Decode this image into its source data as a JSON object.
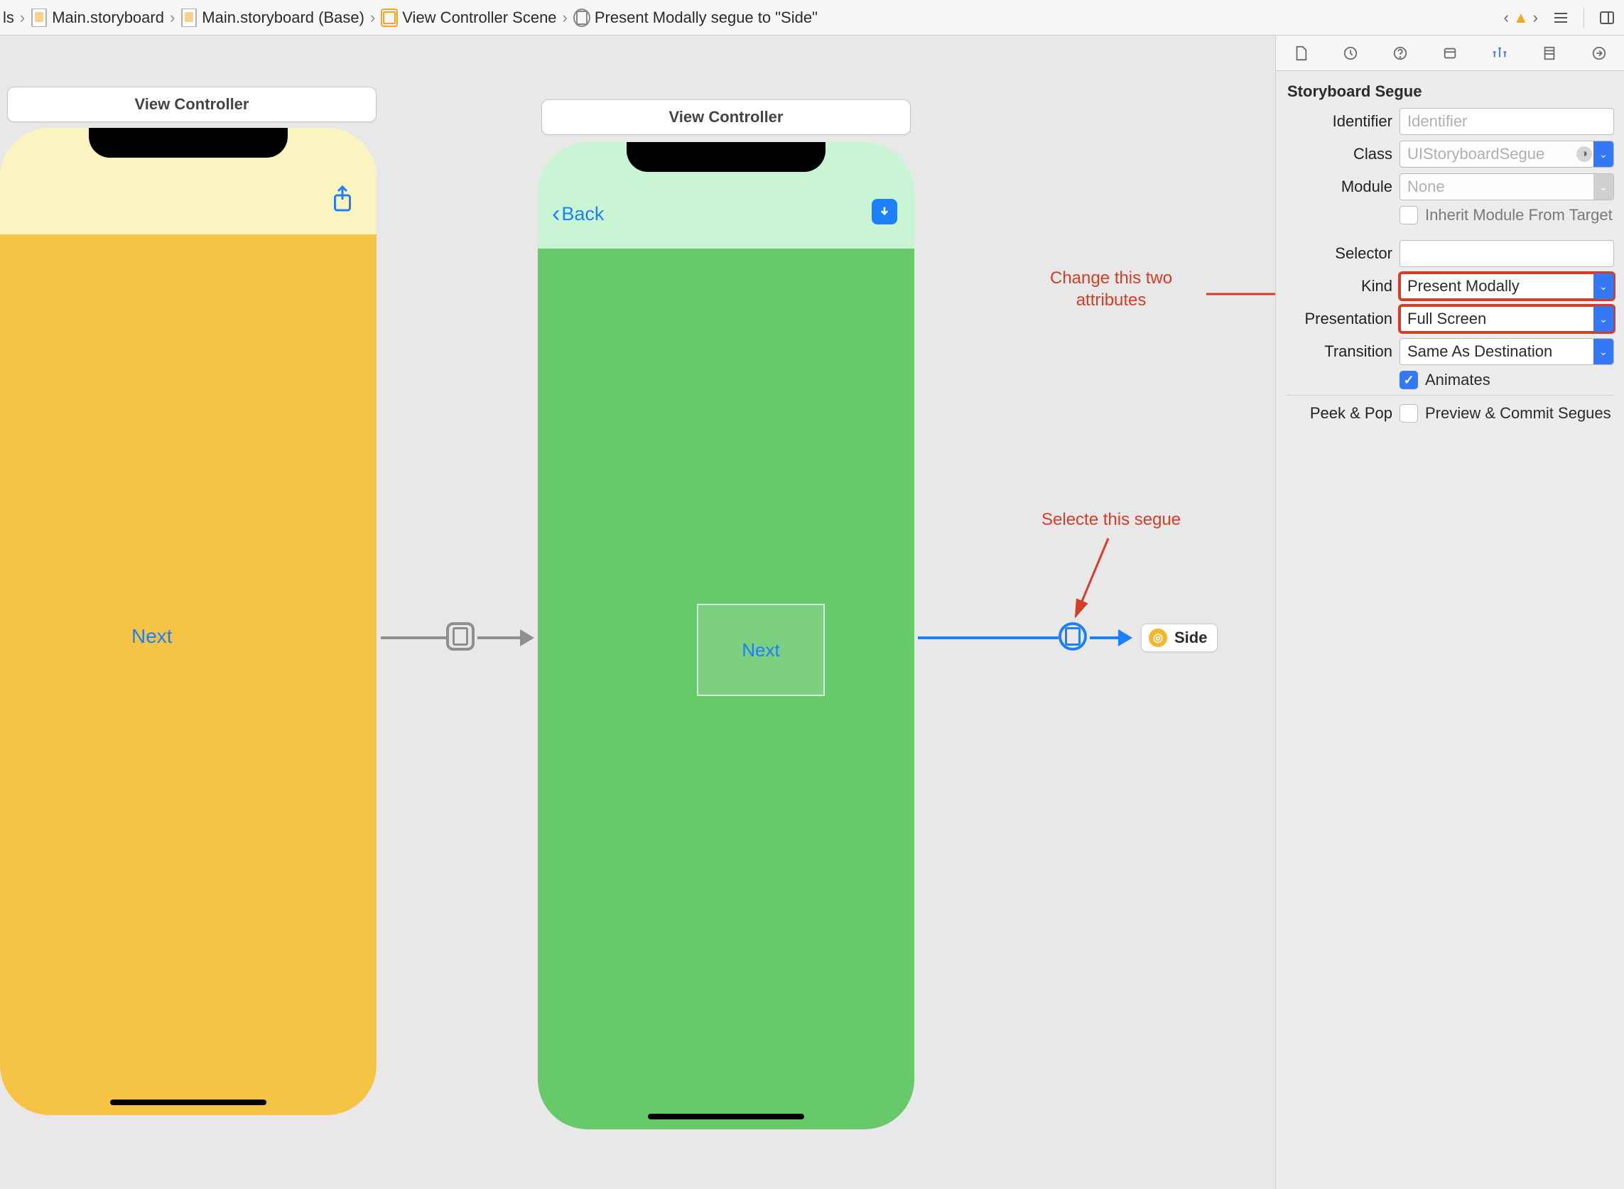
{
  "breadcrumbs": {
    "items": [
      {
        "label": "ls"
      },
      {
        "label": "Main.storyboard"
      },
      {
        "label": "Main.storyboard (Base)"
      },
      {
        "label": "View Controller Scene"
      },
      {
        "label": "Present Modally segue to \"Side\""
      }
    ]
  },
  "toolbar": {
    "prev_aria": "◀",
    "next_aria": "▶"
  },
  "canvas": {
    "scene1_title": "View Controller",
    "scene2_title": "View Controller",
    "scene1_next": "Next",
    "scene2_next": "Next",
    "scene2_back": "Back",
    "side_label": "Side"
  },
  "inspector": {
    "section": "Storyboard Segue",
    "identifier_label": "Identifier",
    "identifier_placeholder": "Identifier",
    "class_label": "Class",
    "class_value": "UIStoryboardSegue",
    "module_label": "Module",
    "module_value": "None",
    "inherit_label": "Inherit Module From Target",
    "selector_label": "Selector",
    "selector_value": "",
    "kind_label": "Kind",
    "kind_value": "Present Modally",
    "presentation_label": "Presentation",
    "presentation_value": "Full Screen",
    "transition_label": "Transition",
    "transition_value": "Same As Destination",
    "animates_label": "Animates",
    "peekpop_label": "Peek & Pop",
    "peekpop_value": "Preview & Commit Segues"
  },
  "annotations": {
    "change_attrs": "Change this two\nattributes",
    "select_segue": "Selecte this segue"
  }
}
